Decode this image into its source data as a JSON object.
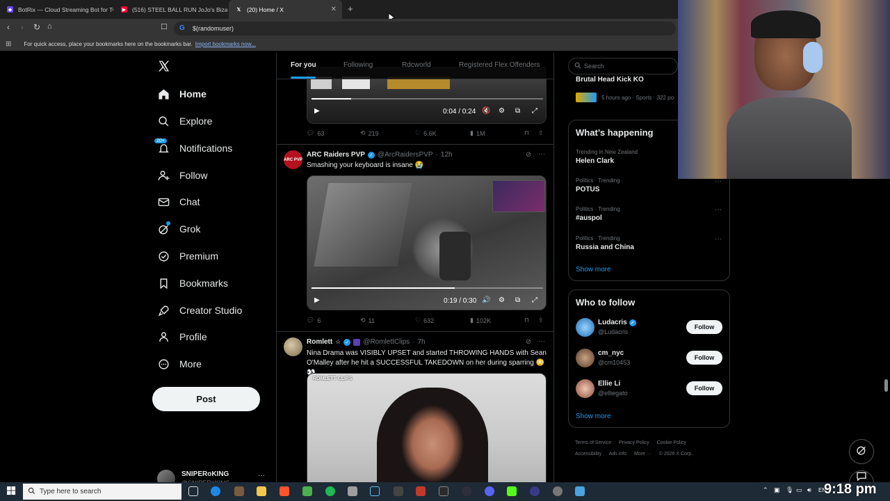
{
  "browser": {
    "tabs": [
      {
        "title": "BotRix — Cloud Streaming Bot for Tw",
        "active": false
      },
      {
        "title": "(516) STEEL BALL RUN JoJo's Bizarre",
        "active": false
      },
      {
        "title": "(20) Home / X",
        "active": true
      }
    ],
    "url": "$(randomuser)",
    "bookmarks_hint": "For quick access, place your bookmarks here on the bookmarks bar.",
    "bookmarks_link": "Import bookmarks now..."
  },
  "nav": {
    "items": [
      {
        "label": "Home",
        "icon": "home-icon"
      },
      {
        "label": "Explore",
        "icon": "search-icon"
      },
      {
        "label": "Notifications",
        "icon": "bell-icon",
        "badge": "20+"
      },
      {
        "label": "Follow",
        "icon": "add-person-icon"
      },
      {
        "label": "Chat",
        "icon": "mail-icon"
      },
      {
        "label": "Grok",
        "icon": "grok-icon"
      },
      {
        "label": "Premium",
        "icon": "premium-icon"
      },
      {
        "label": "Bookmarks",
        "icon": "bookmark-icon"
      },
      {
        "label": "Creator Studio",
        "icon": "rocket-icon"
      },
      {
        "label": "Profile",
        "icon": "person-icon"
      },
      {
        "label": "More",
        "icon": "more-circle-icon"
      }
    ],
    "post_label": "Post",
    "account": {
      "name": "SNIPERoKING",
      "handle": "@SNIPERoKING"
    }
  },
  "feed": {
    "tabs": [
      "For you",
      "Following",
      "Rdcworld",
      "Registered Flex Offenders"
    ],
    "tweet0": {
      "video_time": "0:04 / 0:24",
      "progress": 0.17,
      "stats": {
        "replies": "63",
        "reposts": "219",
        "likes": "6.6K",
        "views": "1M"
      }
    },
    "tweet1": {
      "name": "ARC Raiders PVP",
      "handle": "@ArcRaidersPVP",
      "time": "12h",
      "text": "Smashing your keyboard is insane 😭",
      "avatar_text": "ARC PVP",
      "video_time": "0:19 / 0:30",
      "progress": 0.62,
      "stats": {
        "replies": "6",
        "reposts": "11",
        "likes": "632",
        "views": "102K"
      }
    },
    "tweet2": {
      "name": "Romlett",
      "handle": "@RomlettClips",
      "time": "7h",
      "text": "Nina Drama was VISIBLY UPSET and started THROWING HANDS with Sean O'Malley after he hit a SUCCESSFUL TAKEDOWN on her during sparring 😳👀",
      "watermark": "ROMLETT CLIPS"
    }
  },
  "right": {
    "search_placeholder": "Search",
    "top_story": {
      "title": "Brutal Head Kick KO",
      "meta": "5 hours ago · Sports · 322 po"
    },
    "happening_title": "What’s happening",
    "trends": [
      {
        "category": "Trending in New Zealand",
        "name": "Helen Clark"
      },
      {
        "category": "Politics · Trending",
        "name": "POTUS"
      },
      {
        "category": "Politics · Trending",
        "name": "#auspol"
      },
      {
        "category": "Politics · Trending",
        "name": "Russia and China"
      }
    ],
    "show_more": "Show more",
    "wtf_title": "Who to follow",
    "wtf": [
      {
        "name": "Ludacris",
        "handle": "@Ludacris",
        "verified": true,
        "button": "Follow"
      },
      {
        "name": "cm_nyc",
        "handle": "@cm10453",
        "verified": false,
        "button": "Follow"
      },
      {
        "name": "Ellie Li",
        "handle": "@elliegato",
        "verified": false,
        "button": "Follow"
      }
    ],
    "wtf_show_more": "Show more",
    "footer": [
      "Terms of Service",
      "Privacy Policy",
      "Cookie Policy",
      "Accessibility",
      "Ads info",
      "More ···",
      "© 2026 X Corp."
    ]
  },
  "taskbar": {
    "search_placeholder": "Type here to search",
    "clock": "9:18 pm",
    "lang": "EN"
  },
  "colors": {
    "accent": "#1d9bf0",
    "bg": "#000000",
    "border": "#2f3336",
    "muted": "#71767b"
  }
}
